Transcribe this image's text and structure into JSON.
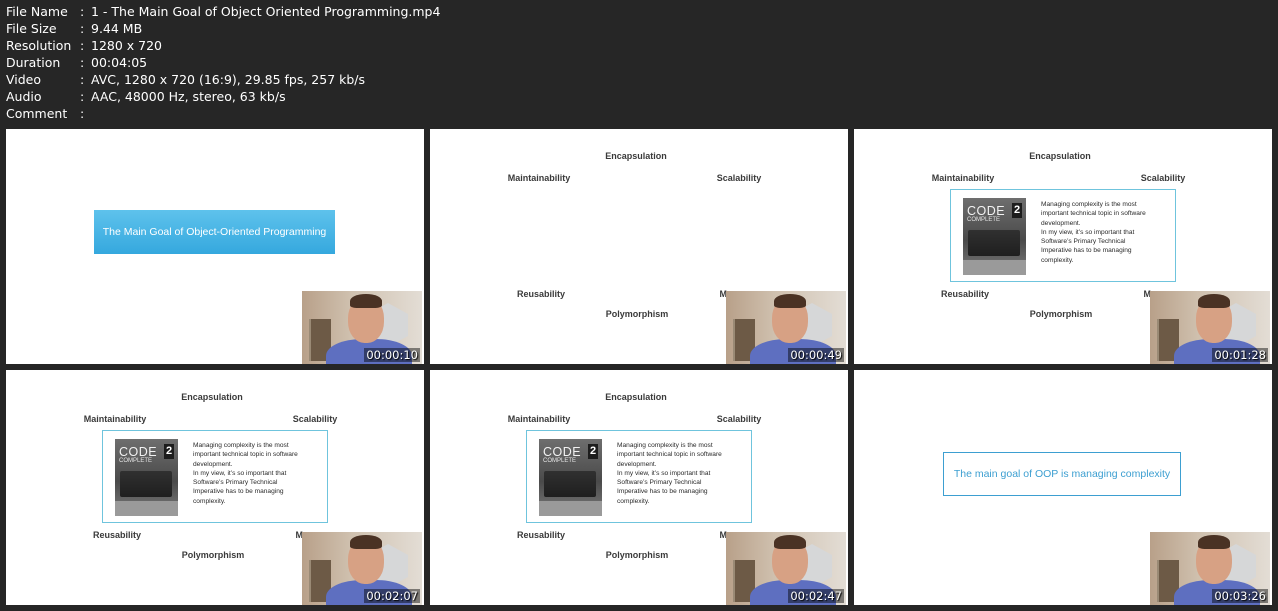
{
  "file_info": [
    {
      "key": "File Name",
      "value": "1 - The Main Goal of Object Oriented Programming.mp4"
    },
    {
      "key": "File Size",
      "value": "9.44 MB"
    },
    {
      "key": "Resolution",
      "value": "1280 x 720"
    },
    {
      "key": "Duration",
      "value": "00:04:05"
    },
    {
      "key": "Video",
      "value": "AVC, 1280 x 720 (16:9), 29.85 fps, 257 kb/s"
    },
    {
      "key": "Audio",
      "value": "AAC, 48000 Hz, stereo, 63 kb/s"
    },
    {
      "key": "Comment",
      "value": ""
    }
  ],
  "separator": ":",
  "slide": {
    "title": "The Main Goal of Object-Oriented Programming",
    "labels": {
      "encapsulation": "Encapsulation",
      "maintainability": "Maintainability",
      "scalability": "Scalability",
      "reusability": "Reusability",
      "polymorphism": "Polymorphism",
      "modularity_partial": "Mo"
    },
    "book": {
      "code": "CODE",
      "complete": "COMPLETE",
      "edition": "2"
    },
    "quote_lines": [
      "Managing complexity is the most",
      "important technical topic in software",
      "development.",
      "In my view, it’s so important that",
      "Software’s Primary Technical",
      "Imperative has to be managing",
      "complexity."
    ],
    "goal": "The main goal of OOP is managing complexity"
  },
  "thumbnails": [
    {
      "timestamp": "00:00:10"
    },
    {
      "timestamp": "00:00:49"
    },
    {
      "timestamp": "00:01:28"
    },
    {
      "timestamp": "00:02:07"
    },
    {
      "timestamp": "00:02:47"
    },
    {
      "timestamp": "00:03:26"
    }
  ]
}
